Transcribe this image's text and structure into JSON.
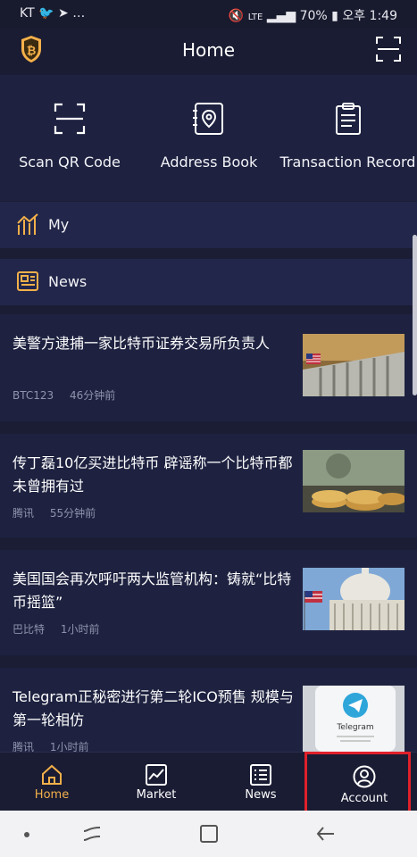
{
  "status_bar": {
    "left": "KT",
    "battery": "70%",
    "time_prefix": "오후",
    "time": "1:49",
    "network": "LTE"
  },
  "header": {
    "title": "Home"
  },
  "quick_actions": [
    {
      "label": "Scan QR Code",
      "icon": "scan-icon"
    },
    {
      "label": "Address Book",
      "icon": "address-book-icon"
    },
    {
      "label": "Transaction Record",
      "icon": "clipboard-icon"
    }
  ],
  "sections": {
    "my": "My",
    "news": "News"
  },
  "news": [
    {
      "title": "美警方逮捕一家比特币证券交易所负责人",
      "source": "BTC123",
      "time": "46分钟前"
    },
    {
      "title": "传丁磊10亿买进比特币 辟谣称一个比特币都未曾拥有过",
      "source": "腾讯",
      "time": "55分钟前"
    },
    {
      "title": "美国国会再次呼吁两大监管机构：铸就“比特币摇篮”",
      "source": "巴比特",
      "time": "1小时前"
    },
    {
      "title": "Telegram正秘密进行第二轮ICO预售 规模与第一轮相仿",
      "source": "腾讯",
      "time": "1小时前"
    }
  ],
  "tabs": [
    {
      "label": "Home",
      "icon": "home-icon",
      "active": true
    },
    {
      "label": "Market",
      "icon": "chart-icon",
      "active": false
    },
    {
      "label": "News",
      "icon": "list-icon",
      "active": false
    },
    {
      "label": "Account",
      "icon": "user-icon",
      "active": false
    }
  ],
  "colors": {
    "accent": "#f4b04a",
    "background": "#1b1d35",
    "card": "#1e2240",
    "highlight": "#e0202a"
  },
  "thumb_texts": {
    "telegram": "Telegram"
  }
}
